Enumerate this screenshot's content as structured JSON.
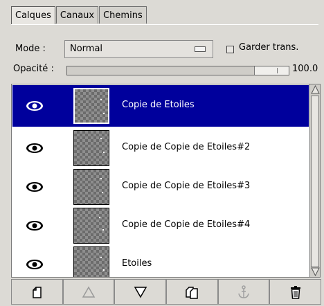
{
  "tabs": [
    {
      "label": "Calques",
      "active": true
    },
    {
      "label": "Canaux",
      "active": false
    },
    {
      "label": "Chemins",
      "active": false
    }
  ],
  "mode": {
    "label": "Mode :",
    "value": "Normal"
  },
  "keep_transparency": {
    "label": "Garder trans.",
    "checked": false
  },
  "opacity": {
    "label": "Opacité :",
    "value": "100.0"
  },
  "layers": [
    {
      "name": "Copie de Etoiles",
      "visible": true,
      "selected": true
    },
    {
      "name": "Copie de Copie de Etoiles#2",
      "visible": true,
      "selected": false
    },
    {
      "name": "Copie de Copie de Etoiles#3",
      "visible": true,
      "selected": false
    },
    {
      "name": "Copie de Copie de Etoiles#4",
      "visible": true,
      "selected": false
    },
    {
      "name": "Etoiles",
      "visible": true,
      "selected": false
    }
  ],
  "toolbar": [
    {
      "icon": "new-layer-icon",
      "enabled": true
    },
    {
      "icon": "raise-layer-icon",
      "enabled": false
    },
    {
      "icon": "lower-layer-icon",
      "enabled": true
    },
    {
      "icon": "duplicate-layer-icon",
      "enabled": true
    },
    {
      "icon": "anchor-layer-icon",
      "enabled": false
    },
    {
      "icon": "delete-layer-icon",
      "enabled": true
    }
  ],
  "colors": {
    "selection": "#00009c",
    "panel": "#dcdad5"
  }
}
